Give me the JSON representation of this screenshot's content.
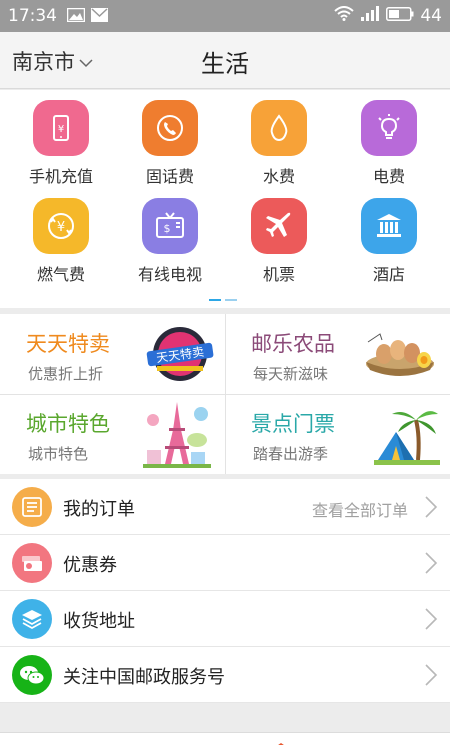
{
  "status_bar": {
    "time": "17:34",
    "battery": "44"
  },
  "header": {
    "city": "南京市",
    "title": "生活"
  },
  "services": [
    {
      "label": "手机充值",
      "icon": "phone-recharge-icon",
      "color": "#f0698f"
    },
    {
      "label": "固话费",
      "icon": "landline-icon",
      "color": "#ef7d2f"
    },
    {
      "label": "水费",
      "icon": "water-drop-icon",
      "color": "#f7a238"
    },
    {
      "label": "电费",
      "icon": "lightbulb-icon",
      "color": "#b86ad9"
    },
    {
      "label": "燃气费",
      "icon": "gas-coin-icon",
      "color": "#f5b82a"
    },
    {
      "label": "有线电视",
      "icon": "cable-tv-icon",
      "color": "#8a7ee3"
    },
    {
      "label": "机票",
      "icon": "airplane-icon",
      "color": "#ec5a5a"
    },
    {
      "label": "酒店",
      "icon": "hotel-building-icon",
      "color": "#3da5ea"
    }
  ],
  "promos": [
    {
      "title": "天天特卖",
      "subtitle": "优惠折上折",
      "title_color": "#ef8a1e",
      "art": "daily-sale-badge",
      "badge_text": "天天特卖"
    },
    {
      "title": "邮乐农品",
      "subtitle": "每天新滋味",
      "title_color": "#8b4a78",
      "art": "eggs-basket-image"
    },
    {
      "title": "城市特色",
      "subtitle": "城市特色",
      "title_color": "#5aa72e",
      "art": "eiffel-tower-image"
    },
    {
      "title": "景点门票",
      "subtitle": "踏春出游季",
      "title_color": "#2aa8a8",
      "art": "tent-palm-image"
    }
  ],
  "menu": [
    {
      "label": "我的订单",
      "hint": "查看全部订单",
      "icon": "order-list-icon",
      "color": "#f5ad4a"
    },
    {
      "label": "优惠券",
      "hint": "",
      "icon": "coupon-icon",
      "color": "#f27680"
    },
    {
      "label": "收货地址",
      "hint": "",
      "icon": "address-layers-icon",
      "color": "#3fb2e8"
    },
    {
      "label": "关注中国邮政服务号",
      "hint": "",
      "icon": "wechat-icon",
      "color": "#17b317"
    }
  ],
  "colors": {
    "accent": "#2ca7e6",
    "arrow": "#b8b8b8"
  }
}
